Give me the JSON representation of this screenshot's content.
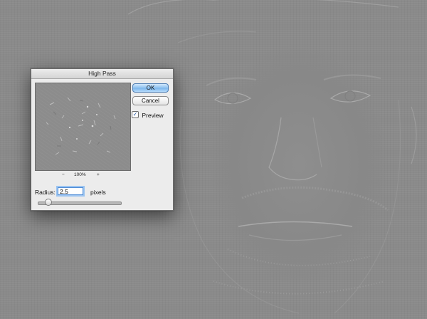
{
  "dialog": {
    "title": "High Pass",
    "ok_label": "OK",
    "cancel_label": "Cancel",
    "preview_label": "Preview",
    "preview_checked": true,
    "zoom": {
      "minus": "−",
      "level": "100%",
      "plus": "+"
    },
    "radius": {
      "label": "Radius:",
      "value": "2.5",
      "unit": "pixels"
    },
    "slider_value_fraction": 0.13
  },
  "colors": {
    "canvas_gray": "#8a8a8a",
    "ok_button_blue": "#8fc2f0",
    "dialog_bg": "#ececec"
  },
  "icons": {
    "checkbox": "checkmark-icon"
  }
}
